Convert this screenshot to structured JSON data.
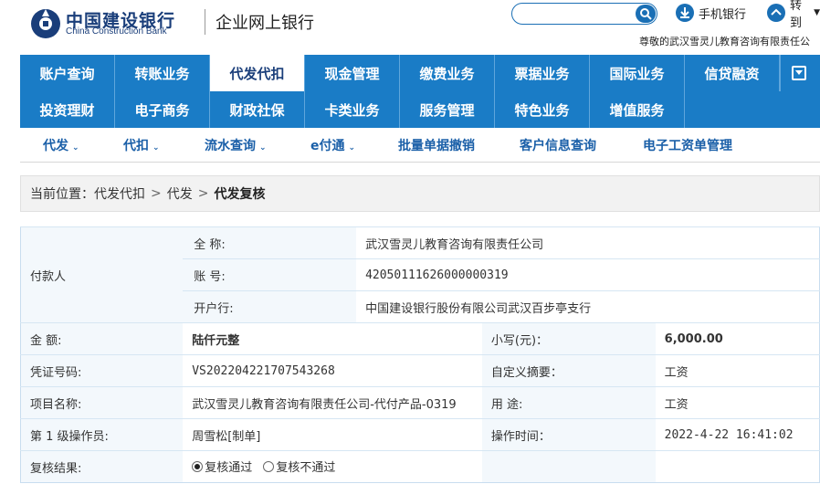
{
  "header": {
    "bank_name_cn": "中国建设银行",
    "bank_name_en": "China Construction Bank",
    "portal_name": "企业网上银行",
    "search_placeholder": "",
    "mobile_bank": "手机银行",
    "goto": "转到",
    "greeting": "尊敬的武汉雪灵儿教育咨询有限责任公"
  },
  "nav_primary": [
    "账户查询",
    "转账业务",
    "代发代扣",
    "现金管理",
    "缴费业务",
    "票据业务",
    "国际业务",
    "信贷融资"
  ],
  "nav_secondary": [
    "投资理财",
    "电子商务",
    "财政社保",
    "卡类业务",
    "服务管理",
    "特色业务",
    "增值服务"
  ],
  "active_nav": "代发代扣",
  "subnav": {
    "daifa": "代发",
    "daikou": "代扣",
    "liushui": "流水查询",
    "efutong": "e付通",
    "batch_cancel": "批量单据撤销",
    "customer_query": "客户信息查询",
    "e_payslip": "电子工资单管理"
  },
  "breadcrumb": {
    "prefix": "当前位置：",
    "level1": "代发代扣",
    "level2": "代发",
    "current": "代发复核",
    "sep": ">"
  },
  "detail": {
    "payer_label": "付款人",
    "full_name_label": "全 称:",
    "full_name": "武汉雪灵儿教育咨询有限责任公司",
    "account_label": "账 号:",
    "account": "42050111626000000319",
    "bank_label": "开户行:",
    "bank": "中国建设银行股份有限公司武汉百步亭支行",
    "amount_label": "金 额:",
    "amount_cn": "陆仟元整",
    "amount_small_label": "小写(元)：",
    "amount_small": "6,000.00",
    "voucher_label": "凭证号码:",
    "voucher": "VS2022042217075432​68",
    "memo_label": "自定义摘要：",
    "memo": "工资",
    "project_label": "项目名称:",
    "project": "武汉雪灵儿教育咨询有限责任公司-代付产品-0319",
    "purpose_label": "用 途:",
    "purpose": "工资",
    "operator_label": "第 1 级操作员:",
    "operator": "周雪松[制单]",
    "op_time_label": "操作时间：",
    "op_time": "2022-4-22 16:41:02",
    "review_label": "复核结果:",
    "review_pass": "复核通过",
    "review_fail": "复核不通过",
    "review_selected": "pass"
  }
}
